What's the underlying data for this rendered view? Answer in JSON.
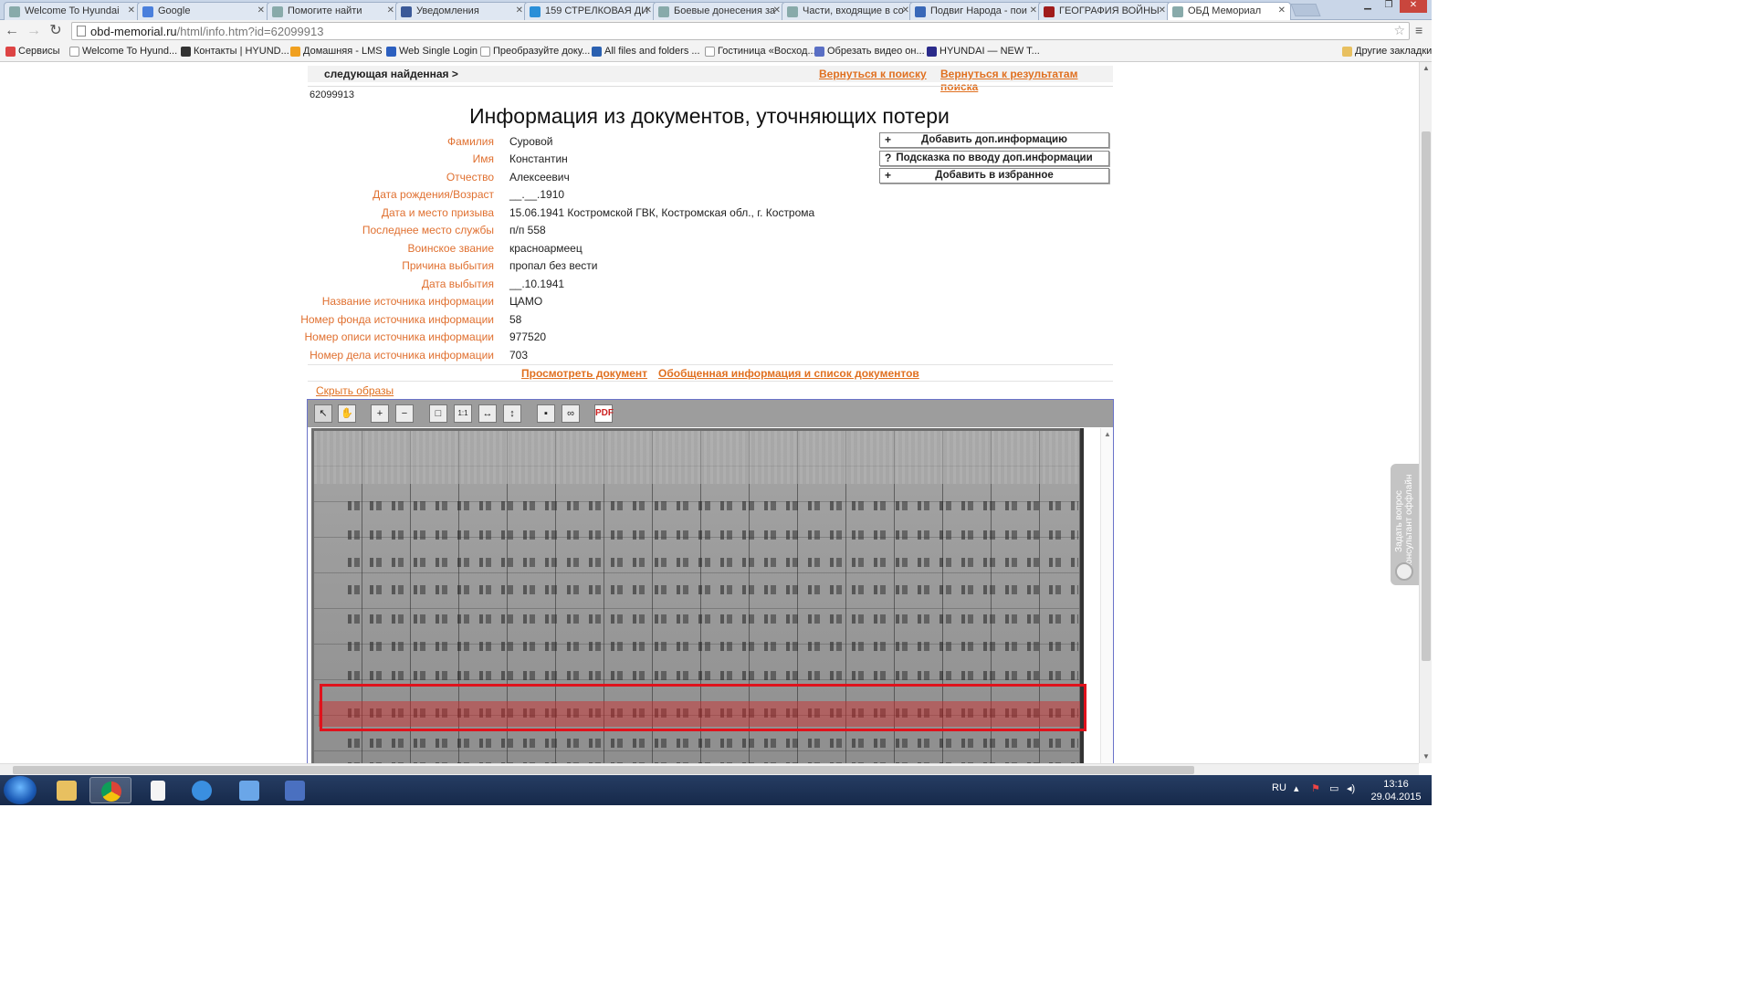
{
  "browser": {
    "tabs": [
      {
        "label": "Welcome To Hyundai",
        "active": false
      },
      {
        "label": "Google",
        "active": false
      },
      {
        "label": "Помогите найти",
        "active": false
      },
      {
        "label": "Уведомления",
        "active": false
      },
      {
        "label": "159 СТРЕЛКОВАЯ ДИ",
        "active": false
      },
      {
        "label": "Боевые донесения за",
        "active": false
      },
      {
        "label": "Части, входящие в со",
        "active": false
      },
      {
        "label": "Подвиг Народа - пои",
        "active": false
      },
      {
        "label": "ГЕОГРАФИЯ ВОЙНЫ",
        "active": false
      },
      {
        "label": "ОБД Мемориал",
        "active": true
      }
    ],
    "url_host": "obd-memorial.ru",
    "url_path": "/html/info.htm?id=62099913",
    "bookmarks": [
      "Сервисы",
      "Welcome To Hyund...",
      "Контакты | HYUND...",
      "Домашняя - LMS",
      "Web Single Login",
      "Преобразуйте доку...",
      "All files and folders ...",
      "Гостиница «Восход...",
      "Обрезать видео он...",
      "HYUNDAI — NEW T..."
    ],
    "other_bookmarks": "Другие закладки"
  },
  "page": {
    "next_found": "следующая найденная >",
    "back_to_search": "Вернуться к поиску",
    "back_to_results": "Вернуться к результатам поиска",
    "record_id": "62099913",
    "title": "Информация из документов, уточняющих потери",
    "fields": [
      {
        "label": "Фамилия",
        "value": "Суровой"
      },
      {
        "label": "Имя",
        "value": "Константин"
      },
      {
        "label": "Отчество",
        "value": "Алексеевич"
      },
      {
        "label": "Дата рождения/Возраст",
        "value": "__.__.1910"
      },
      {
        "label": "Дата и место призыва",
        "value": "15.06.1941 Костромской ГВК, Костромская обл., г. Кострома"
      },
      {
        "label": "Последнее место службы",
        "value": "п/п 558"
      },
      {
        "label": "Воинское звание",
        "value": "красноармеец"
      },
      {
        "label": "Причина выбытия",
        "value": "пропал без вести"
      },
      {
        "label": "Дата выбытия",
        "value": "__.10.1941"
      },
      {
        "label": "Название источника информации",
        "value": "ЦАМО"
      },
      {
        "label": "Номер фонда источника информации",
        "value": "58"
      },
      {
        "label": "Номер описи источника информации",
        "value": "977520"
      },
      {
        "label": "Номер дела источника информации",
        "value": "703"
      }
    ],
    "side_buttons": [
      {
        "symbol": "+",
        "label": "Добавить доп.информацию"
      },
      {
        "symbol": "?",
        "label": "Подсказка по вводу доп.информации"
      },
      {
        "symbol": "+",
        "label": "Добавить в избранное"
      }
    ],
    "view_document": "Просмотреть документ",
    "summary_info": "Обобщенная информация и список документов",
    "hide_images": "Скрыть образы",
    "viewer_tools": [
      {
        "name": "select-tool",
        "glyph": "↖"
      },
      {
        "name": "pan-tool",
        "glyph": "✋"
      },
      {
        "name": "zoom-in",
        "glyph": "+"
      },
      {
        "name": "zoom-out",
        "glyph": "−"
      },
      {
        "name": "fit-page",
        "glyph": "□"
      },
      {
        "name": "actual-size",
        "glyph": "1:1"
      },
      {
        "name": "fit-width",
        "glyph": "↔"
      },
      {
        "name": "fit-height",
        "glyph": "↕"
      },
      {
        "name": "save",
        "glyph": "▪"
      },
      {
        "name": "link",
        "glyph": "∞"
      },
      {
        "name": "pdf",
        "glyph": "PDF"
      }
    ],
    "feedback": "Задать вопрос консультант оффлайн"
  },
  "taskbar": {
    "lang": "RU",
    "time": "13:16",
    "date": "29.04.2015"
  }
}
